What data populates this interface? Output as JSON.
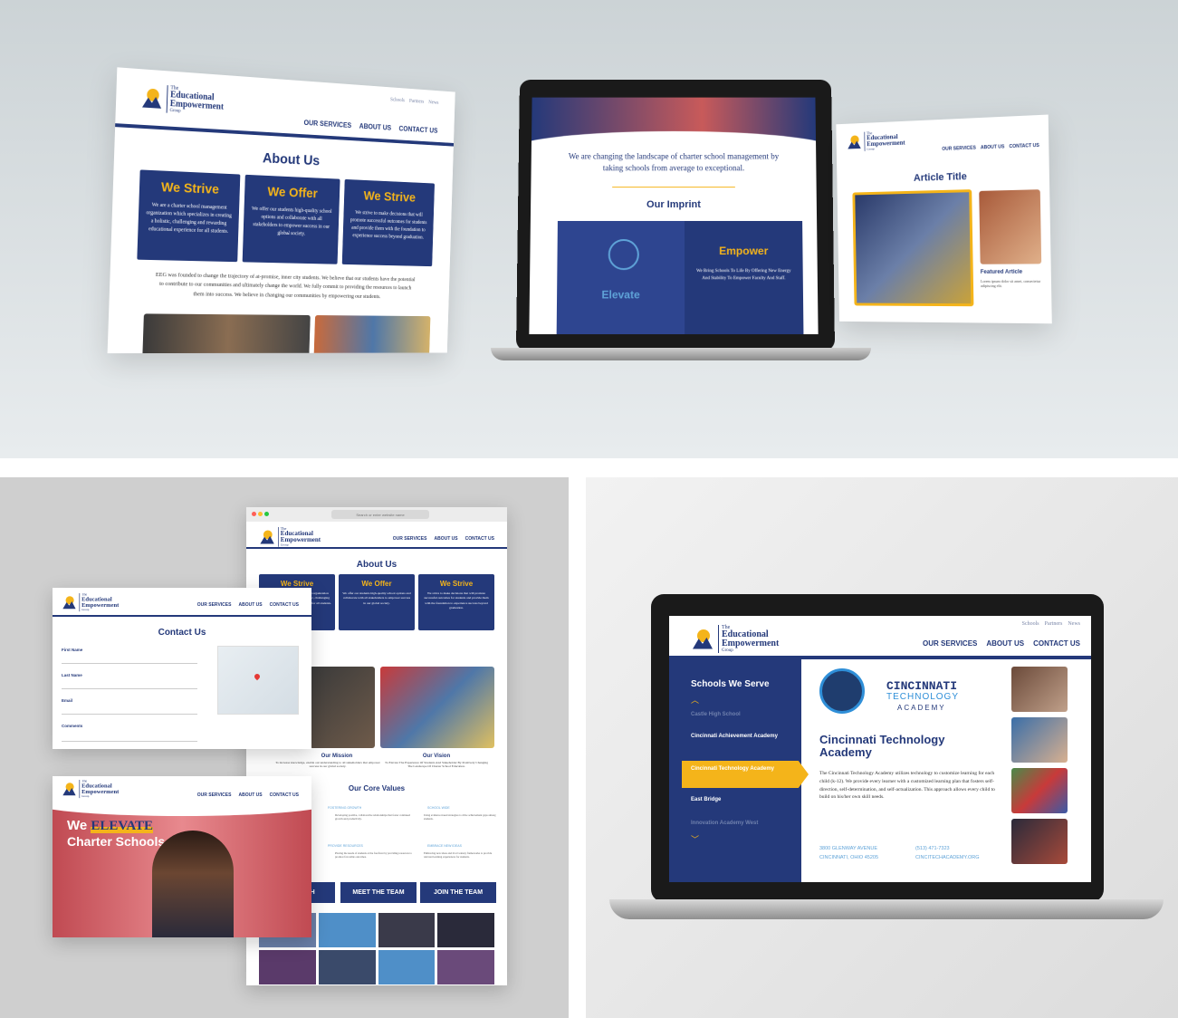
{
  "brand": {
    "line1": "The",
    "line2": "Educational",
    "line3": "Empowerment",
    "line4": "Group"
  },
  "nav": {
    "services": "OUR SERVICES",
    "about": "ABOUT US",
    "contact": "CONTACT US"
  },
  "utility": {
    "schools": "Schools",
    "partners": "Partners",
    "news": "News"
  },
  "about": {
    "title": "About Us",
    "cards": [
      {
        "title": "We Strive",
        "text": "We are a charter school management organization which specializes in creating a holistic, challenging and rewarding educational experience for all students."
      },
      {
        "title": "We Offer",
        "text": "We offer our students high-quality school options and collaborate with all stakeholders to empower success in our global society."
      },
      {
        "title": "We Strive",
        "text": "We strive to make decisions that will promote successful outcomes for students and provide them with the foundation to experience success beyond graduation."
      }
    ],
    "paragraph": "EEG was founded to change the trajectory of at-promise, inner city students. We believe that our students have the potential to contribute to our communities and ultimately change the world. We fully commit to providing the resources to launch them into success. We believe in changing our communities by empowering our students."
  },
  "imprint": {
    "hero_text": "We are changing the landscape of charter school management by taking schools from average to exceptional.",
    "title": "Our Imprint",
    "elevate": "Elevate",
    "empower": "Empower",
    "empower_text": "We Bring Schools To Life By Offering New Energy And Stability To Empower Faculty And Staff."
  },
  "article": {
    "title": "Article Title",
    "featured": "Featured Article",
    "text": "Lorem ipsum dolor sit amet, consectetur adipiscing elit."
  },
  "browser": {
    "search_placeholder": "Search or enter website name"
  },
  "contact": {
    "title": "Contact Us",
    "first_name": "First Name",
    "last_name": "Last Name",
    "email": "Email",
    "comments": "Comments"
  },
  "mission": {
    "mission_title": "Our Mission",
    "mission_text": "To increase knowledge, enable our understanding to all stakeholders that empower success in our global society.",
    "vision_title": "Our Vision",
    "vision_text": "To Elevate The Experience Of Students And Stakeholder By Positively Changing The Landscape Of Charter School Education."
  },
  "values": {
    "title": "Our Core Values",
    "items": [
      "FOSTERING GROWTH",
      "SCHOOL WIDE",
      "PROVIDE RESOURCES",
      "EMBRACE NEW IDEAS"
    ],
    "texts": [
      "Developing positive, collaborative relationships that foster continued growth and productivity.",
      "Using evidence-based strategies to drive achievement gaps among students.",
      "Placing the needs of students at the forefront by providing resources to produce favorable outcomes.",
      "Embracing new ideas and 21st Century frameworks to provide relevant learning experiences for students."
    ]
  },
  "buttons": {
    "research": "RESEARCH",
    "team": "MEET THE TEAM",
    "join": "JOIN THE TEAM"
  },
  "hero": {
    "we": "We",
    "elevate": "ELEVATE",
    "charter": "Charter Schools"
  },
  "schools": {
    "title": "Schools We Serve",
    "list": [
      "Castle High School",
      "Cincinnati Achievement Academy",
      "Cincinnati Technology Academy",
      "East Bridge",
      "Innovation Academy West"
    ],
    "active_index": 2,
    "logo_line1": "CINCINNATI",
    "logo_line2": "TECHNOLOGY",
    "logo_line3": "ACADEMY",
    "school_name": "Cincinnati Technology Academy",
    "description": "The Cincinnati Technology Academy utilizes technology to customize learning for each child (k-12). We provide every learner with a customized learning plan that fosters self-direction, self-determination, and self-actualization. This approach allows every child to build on his/her own skill needs.",
    "address1": "3800 GLENWAY AVENUE",
    "address2": "CINCINNATI, OHIO 45205",
    "phone": "(513) 471-7323",
    "web": "CINCITECHACADEMY.ORG"
  },
  "colors": {
    "navy": "#24397a",
    "gold": "#f4b41a",
    "cream": "#ffffff"
  }
}
